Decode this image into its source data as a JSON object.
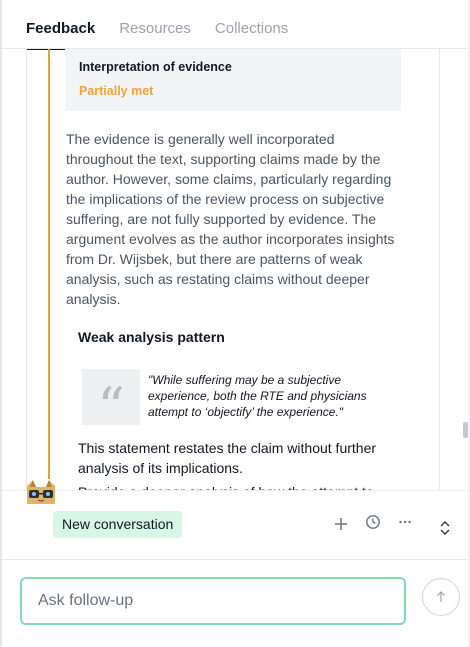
{
  "tabs": [
    {
      "label": "Feedback",
      "active": true
    },
    {
      "label": "Resources",
      "active": false
    },
    {
      "label": "Collections",
      "active": false
    }
  ],
  "evidence": {
    "title": "Interpretation of evidence",
    "status": "Partially met",
    "status_color": "#f0a23b"
  },
  "body_text": "The evidence is generally well incorporated throughout the text, supporting claims made by the author. However, some claims, particularly regarding the implications of the review process on subjective suffering, are not fully supported by evidence. The argument evolves as the author incorporates insights from Dr. Wijsbek, but there are patterns of weak analysis, such as restating claims without deeper analysis.",
  "weak_analysis": {
    "title": "Weak analysis pattern",
    "quote": "\"While suffering may be a subjective experience, both the RTE and physicians attempt to ‘objectify’ the experience.\"",
    "comment": "This statement restates the claim without further analysis of its implications.",
    "cutoff_text": "Provide a deeper analysis of how the attempt to"
  },
  "conversation": {
    "new_label": "New conversation",
    "input_placeholder": "Ask follow-up",
    "input_value": ""
  },
  "icons": {
    "add": "plus-icon",
    "history": "clock-icon",
    "more": "ellipsis-icon",
    "expand": "chevron-up-down-icon",
    "send": "arrow-up-icon",
    "quote": "quote-icon",
    "avatar": "cat-avatar-icon"
  },
  "colors": {
    "accent_line": "#e3a33a",
    "new_conv_bg": "#d8f5e6",
    "input_border": "#7ddcb1"
  }
}
